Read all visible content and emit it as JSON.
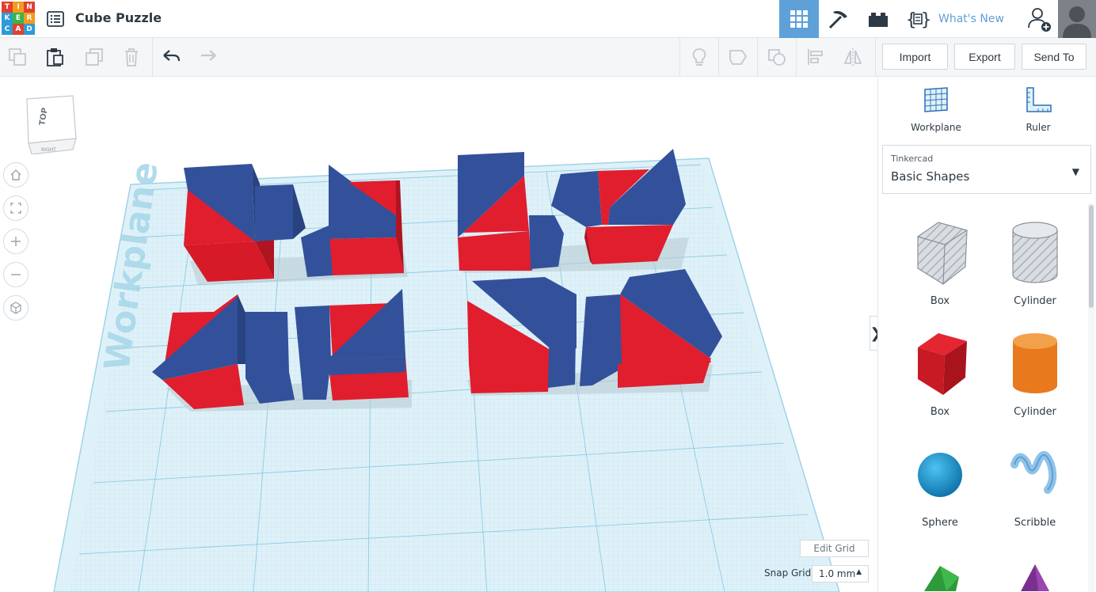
{
  "app": {
    "title": "Cube Puzzle",
    "logo_letters": [
      "T",
      "I",
      "N",
      "K",
      "E",
      "R",
      "C",
      "A",
      "D"
    ],
    "logo_colors": [
      "#e0412f",
      "#f29b1e",
      "#e0412f",
      "#2d9bd7",
      "#38b44a",
      "#f29b1e",
      "#2d9bd7",
      "#e0412f",
      "#2d9bd7"
    ]
  },
  "topnav": {
    "items": [
      "grid-icon",
      "pickaxe-icon",
      "bricks-icon",
      "codeblocks-icon"
    ],
    "whats_new": "What's New",
    "active_color": "#5ea0d8"
  },
  "toolbar": {
    "icons": [
      "copy-icon",
      "paste-icon",
      "duplicate-icon",
      "delete-icon",
      "undo-icon",
      "redo-icon",
      "light-icon",
      "note-icon",
      "hole-icon",
      "align-icon",
      "mirror-icon"
    ],
    "import_label": "Import",
    "export_label": "Export",
    "send_to_label": "Send To"
  },
  "viewcube": {
    "top_label": "TOP",
    "right_label": "RIGHT"
  },
  "view_controls": [
    "home-icon",
    "fit-icon",
    "zoom-in-icon",
    "zoom-out-icon",
    "perspective-icon"
  ],
  "workplane": {
    "label": "Workplane",
    "edit_grid_label": "Edit Grid",
    "snap_grid_label": "Snap Grid",
    "snap_grid_value": "1.0 mm"
  },
  "panel": {
    "tools": [
      {
        "label": "Workplane"
      },
      {
        "label": "Ruler"
      }
    ],
    "library_source": "Tinkercad",
    "library_name": "Basic Shapes",
    "shapes": [
      {
        "label": "Box",
        "color": "#c7ccd2"
      },
      {
        "label": "Cylinder",
        "color": "#c7ccd2"
      },
      {
        "label": "Box",
        "color": "#d0202a"
      },
      {
        "label": "Cylinder",
        "color": "#e8791c"
      },
      {
        "label": "Sphere",
        "color": "#1b9bd8"
      },
      {
        "label": "Scribble",
        "color": "#8fc3ea"
      }
    ]
  },
  "colors": {
    "red": "#e01e2e",
    "blue": "#33519b",
    "grid": "#c9e7f2"
  }
}
